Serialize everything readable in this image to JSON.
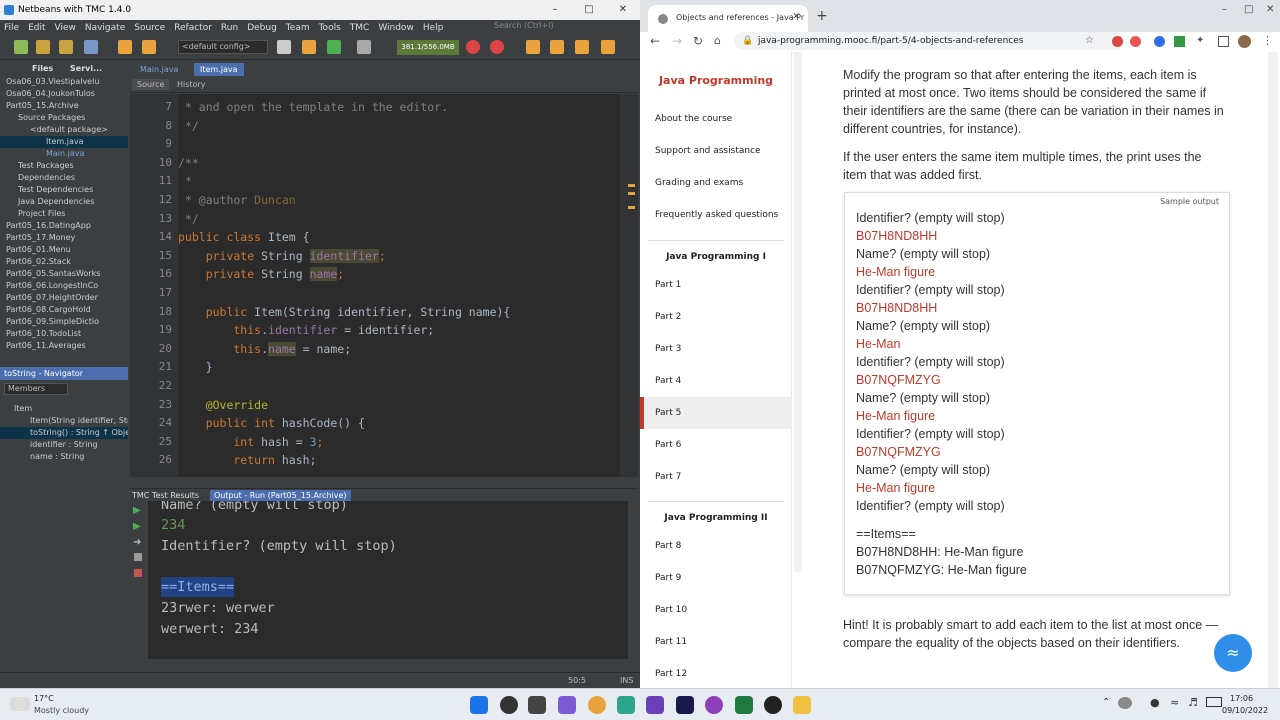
{
  "netbeans": {
    "title": "Netbeans with TMC 1.4.0",
    "menu": [
      "File",
      "Edit",
      "View",
      "Navigate",
      "Source",
      "Refactor",
      "Run",
      "Debug",
      "Team",
      "Tools",
      "TMC",
      "Window",
      "Help"
    ],
    "search_placeholder": "Search (Ctrl+I)",
    "config": "<default config>",
    "memory": "381.1/556.0MB",
    "proj_tabs": [
      "Files",
      "Servi..."
    ],
    "projects": [
      "Osa06_03.Viestipalvelu",
      "Osa06_04.JoukonTulos",
      "Part05_15.Archive",
      "Source Packages",
      "<default package>",
      "Item.java",
      "Main.java",
      "Test Packages",
      "Dependencies",
      "Test Dependencies",
      "Java Dependencies",
      "Project Files",
      "Part05_16.DatingApp",
      "Part05_17.Money",
      "Part06_01.Menu",
      "Part06_02.Stack",
      "Part06_05.SantasWorks",
      "Part06_06.LongestInCo",
      "Part06_07.HeightOrder",
      "Part06_08.CargoHold",
      "Part06_09.SimpleDictio",
      "Part06_10.TodoList",
      "Part06_11.Averages"
    ],
    "navigator_title": "toString - Navigator",
    "navigator_select": "Members",
    "navigator": [
      "Item",
      "Item(String identifier, String",
      "toString() : String ↑ Object",
      "identifier : String",
      "name : String"
    ],
    "editor_tabs": [
      "Main.java",
      "Item.java"
    ],
    "editor_toolbar": [
      "Source",
      "History"
    ],
    "line_numbers": [
      "7",
      "8",
      "9",
      "10",
      "11",
      "12",
      "13",
      "14",
      "15",
      "16",
      "17",
      "18",
      "19",
      "20",
      "21",
      "22",
      "23",
      "24",
      "25",
      "26"
    ],
    "code": {
      "l7": " * and open the template in the editor.",
      "l8": " */",
      "l10": "/**",
      "l11": " *",
      "l12a": " * @author",
      "l12b": " Duncan",
      "l13": " */",
      "l14a": "public class",
      "l14b": " Item {",
      "l15a": "    private",
      "l15b": " String ",
      "l15c": "identifier",
      "l15d": ";",
      "l16a": "    private",
      "l16b": " String ",
      "l16c": "name",
      "l16d": ";",
      "l18a": "    public",
      "l18b": " Item(String identifier, String name){",
      "l19a": "        this",
      "l19b": ".",
      "l19c": "identifier",
      "l19d": " = identifier;",
      "l20a": "        this",
      "l20b": ".",
      "l20c": "name",
      "l20d": " = name;",
      "l21": "    }",
      "l23": "    @Override",
      "l24a": "    public int",
      "l24b": " hashCode() {",
      "l25a": "        int",
      "l25b": " hash = ",
      "l25c": "3",
      "l25d": ";",
      "l26a": "        return",
      "l26b": " hash;"
    },
    "output_tabs": [
      "TMC Test Results",
      "Output - Run (Part05_15.Archive)"
    ],
    "output": [
      "Name? (empty will stop)",
      "234",
      "Identifier? (empty will stop)",
      "",
      "==Items==",
      "23rwer: werwer",
      "werwert: 234"
    ],
    "status_pos": "50:5",
    "status_mode": "INS"
  },
  "browser": {
    "tab_title": "Objects and references - Java Pr",
    "url": "java-programming.mooc.fi/part-5/4-objects-and-references",
    "sidebar_title": "Java Programming",
    "sidebar_links": [
      "About the course",
      "Support and assistance",
      "Grading and exams",
      "Frequently asked questions"
    ],
    "section1": "Java Programming I",
    "parts1": [
      "Part 1",
      "Part 2",
      "Part 3",
      "Part 4",
      "Part 5",
      "Part 6",
      "Part 7"
    ],
    "section2": "Java Programming II",
    "parts2": [
      "Part 8",
      "Part 9",
      "Part 10",
      "Part 11",
      "Part 12"
    ],
    "para1": "Modify the program so that after entering the items, each item is printed at most once. Two items should be considered the same if their identifiers are the same (there can be variation in their names in different countries, for instance).",
    "para2": "If the user enters the same item multiple times, the print uses the item that was added first.",
    "sample_label": "Sample output",
    "sample": [
      "Identifier? (empty will stop)",
      "B07H8ND8HH",
      "Name? (empty will stop)",
      "He-Man figure",
      "Identifier? (empty will stop)",
      "B07H8ND8HH",
      "Name? (empty will stop)",
      "He-Man",
      "Identifier? (empty will stop)",
      "B07NQFMZYG",
      "Name? (empty will stop)",
      "He-Man figure",
      "Identifier? (empty will stop)",
      "B07NQFMZYG",
      "Name? (empty will stop)",
      "He-Man figure",
      "Identifier? (empty will stop)"
    ],
    "sample_items": [
      "==Items==",
      "B07H8ND8HH: He-Man figure",
      "B07NQFMZYG: He-Man figure"
    ],
    "hint": "Hint! It is probably smart to add each item to the list at most once — compare the equality of the objects based on their identifiers."
  },
  "taskbar": {
    "temp": "17°C",
    "weather": "Mostly cloudy",
    "time": "17:06",
    "date": "09/10/2022"
  }
}
